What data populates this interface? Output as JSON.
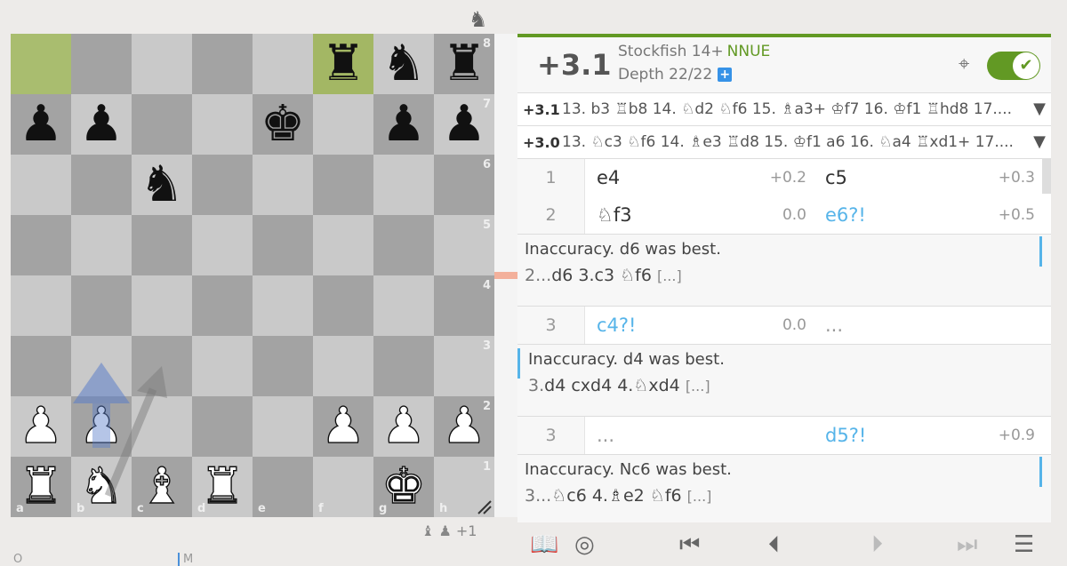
{
  "top_icon": "knight-icon",
  "board": {
    "ranks": [
      "8",
      "7",
      "6",
      "5",
      "4",
      "3",
      "2",
      "1"
    ],
    "files": [
      "a",
      "b",
      "c",
      "d",
      "e",
      "f",
      "g",
      "h"
    ],
    "pieces": {
      "f8": "♜",
      "g8": "♞",
      "h8": "♜",
      "a7": "♟",
      "b7": "♟",
      "e7": "♚",
      "g7": "♟",
      "h7": "♟",
      "c6": "♞",
      "a2": "♙",
      "b2": "♙",
      "f2": "♙",
      "g2": "♙",
      "h2": "♙",
      "a1": "♖",
      "b1": "♘",
      "c1": "♗",
      "d1": "♖",
      "g1": "♔"
    },
    "highlights": [
      "a8",
      "f8"
    ]
  },
  "material": {
    "icons": [
      "bishop-icon",
      "pawn-icon"
    ],
    "score": "+1"
  },
  "ceval": {
    "eval": "+3.1",
    "engine": "Stockfish 14+",
    "nnue": "NNUE",
    "depth": "Depth 22/22",
    "plus": "+",
    "toggle_check": "✔",
    "accent": "#629924"
  },
  "pvs": [
    {
      "eval": "+3.1",
      "line": "13. b3 ♖b8 14. ♘d2 ♘f6 15. ♗a3+ ♔f7 16. ♔f1 ♖hd8 17...."
    },
    {
      "eval": "+3.0",
      "line": "13. ♘c3 ♘f6 14. ♗e3 ♖d8 15. ♔f1 a6 16. ♘a4 ♖xd1+ 17...."
    }
  ],
  "moves": {
    "row1": {
      "num": "1",
      "white": "e4",
      "white_eval": "+0.2",
      "black": "c5",
      "black_eval": "+0.3"
    },
    "row2": {
      "num": "2",
      "white": "♘f3",
      "white_eval": "0.0",
      "black": "e6?!",
      "black_eval": "+0.5"
    },
    "comment1": {
      "text": "Inaccuracy. d6 was best.",
      "num": "2...",
      "line": "d6 3.c3 ♘f6",
      "more": "[...]"
    },
    "row3": {
      "num": "3",
      "white": "c4?!",
      "white_eval": "0.0",
      "black": "..."
    },
    "comment2": {
      "text": "Inaccuracy. d4 was best.",
      "num": "3.",
      "line": "d4 cxd4 4.♘xd4",
      "more": "[...]"
    },
    "row4": {
      "num": "3",
      "white": "...",
      "black": "d5?!",
      "black_eval": "+0.9"
    },
    "comment3": {
      "text": "Inaccuracy. Nc6 was best.",
      "num": "3...",
      "line": "♘c6 4.♗e2 ♘f6",
      "more": "[...]"
    }
  },
  "controls": [
    "book-icon",
    "target-icon",
    "first-icon",
    "prev-icon",
    "next-icon",
    "last-icon",
    "menu-icon"
  ],
  "bottom_hints": {
    "left": "O",
    "mid": "M"
  }
}
